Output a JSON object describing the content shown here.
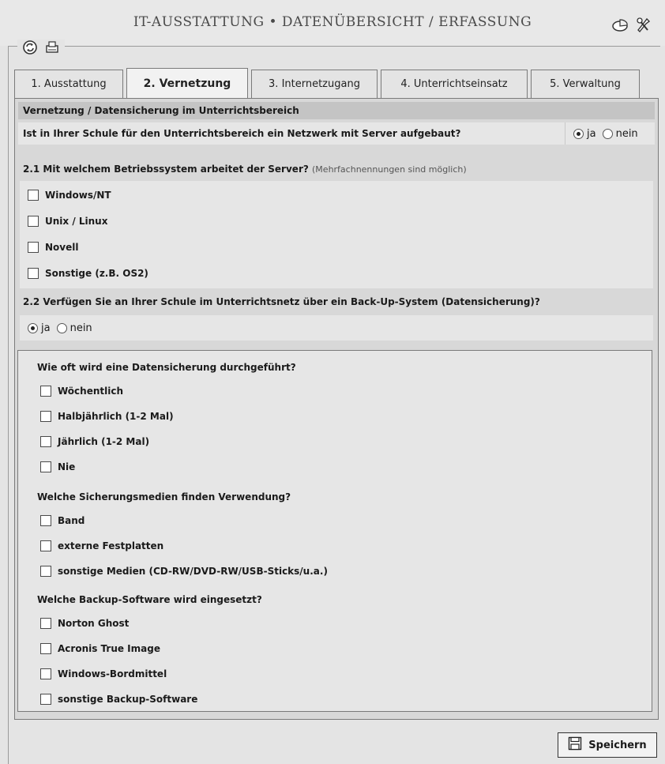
{
  "header": {
    "title": "IT-AUSSTATTUNG • DATENÜBERSICHT / ERFASSUNG",
    "icons": [
      "chart-icon",
      "tools-icon"
    ]
  },
  "toolbar": {
    "icons": [
      "refresh-icon",
      "print-icon"
    ]
  },
  "tabs": [
    {
      "label": "1. Ausstattung",
      "active": false
    },
    {
      "label": "2. Vernetzung",
      "active": true
    },
    {
      "label": "3. Internetzugang",
      "active": false
    },
    {
      "label": "4. Unterrichtseinsatz",
      "active": false
    },
    {
      "label": "5. Verwaltung",
      "active": false
    }
  ],
  "section": {
    "header": "Vernetzung / Datensicherung im Unterrichtsbereich",
    "network_question": "Ist in Ihrer Schule für den Unterrichtsbereich ein Netzwerk mit Server aufgebaut?",
    "network_answer": {
      "ja": "ja",
      "nein": "nein",
      "selected": "ja"
    },
    "q21": {
      "label": "2.1 Mit welchem Betriebssystem arbeitet der Server?",
      "hint": "(Mehrfachnennungen sind möglich)",
      "options": [
        "Windows/NT",
        "Unix / Linux",
        "Novell",
        "Sonstige (z.B. OS2)"
      ]
    },
    "q22": {
      "label": "2.2 Verfügen Sie an Ihrer Schule im Unterrichtsnetz über ein Back-Up-System (Datensicherung)?",
      "answer": {
        "ja": "ja",
        "nein": "nein",
        "selected": "ja"
      }
    },
    "backup": {
      "frequency_question": "Wie oft wird eine Datensicherung durchgeführt?",
      "frequency_options": [
        "Wöchentlich",
        "Halbjährlich (1-2 Mal)",
        "Jährlich (1-2 Mal)",
        "Nie"
      ],
      "media_question": "Welche Sicherungsmedien finden Verwendung?",
      "media_options": [
        "Band",
        "externe Festplatten",
        "sonstige Medien (CD-RW/DVD-RW/USB-Sticks/u.a.)"
      ],
      "software_question": "Welche Backup-Software wird eingesetzt?",
      "software_options": [
        "Norton Ghost",
        "Acronis True Image",
        "Windows-Bordmittel",
        "sonstige Backup-Software"
      ]
    }
  },
  "save_button": {
    "label": "Speichern",
    "icon": "save-icon"
  }
}
